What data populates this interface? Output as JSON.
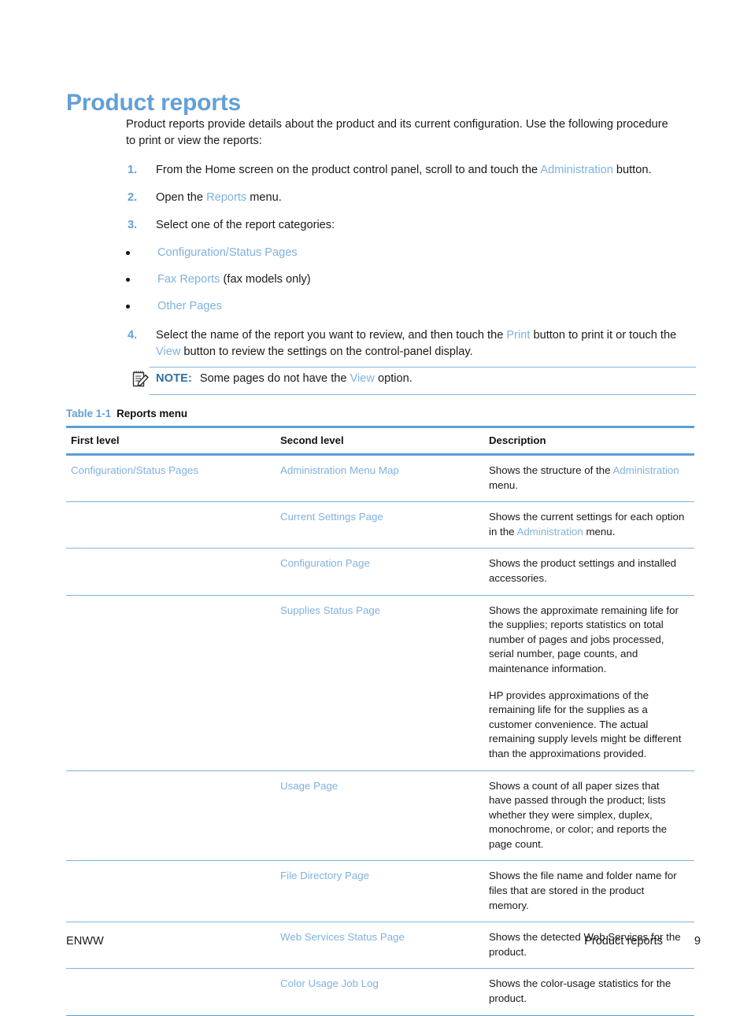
{
  "heading": "Product reports",
  "intro": "Product reports provide details about the product and its current configuration. Use the following procedure to print or view the reports:",
  "steps": [
    {
      "num": "1.",
      "parts": [
        {
          "t": "From the Home screen on the product control panel, scroll to and touch the ",
          "link": false
        },
        {
          "t": "Administration",
          "link": true
        },
        {
          "t": " button.",
          "link": false
        }
      ]
    },
    {
      "num": "2.",
      "parts": [
        {
          "t": "Open the ",
          "link": false
        },
        {
          "t": "Reports",
          "link": true
        },
        {
          "t": " menu.",
          "link": false
        }
      ]
    },
    {
      "num": "3.",
      "parts": [
        {
          "t": "Select one of the report categories:",
          "link": false
        }
      ]
    },
    {
      "num": "4.",
      "parts": [
        {
          "t": "Select the name of the report you want to review, and then touch the ",
          "link": false
        },
        {
          "t": "Print",
          "link": true
        },
        {
          "t": " button to print it or touch the ",
          "link": false
        },
        {
          "t": "View",
          "link": true
        },
        {
          "t": " button to review the settings on the control-panel display.",
          "link": false
        }
      ]
    }
  ],
  "bullets": [
    [
      {
        "t": "Configuration/Status Pages",
        "link": true
      }
    ],
    [
      {
        "t": "Fax Reports",
        "link": true
      },
      {
        "t": " (fax models only)",
        "link": false
      }
    ],
    [
      {
        "t": "Other Pages",
        "link": true
      }
    ]
  ],
  "note": {
    "icon": "note-pad-pencil-icon",
    "label": "NOTE:",
    "parts": [
      {
        "t": "Some pages do not have the ",
        "link": false
      },
      {
        "t": "View",
        "link": true
      },
      {
        "t": " option.",
        "link": false
      }
    ]
  },
  "table": {
    "caption_number": "Table 1-1",
    "caption_title": "Reports menu",
    "columns": [
      "First level",
      "Second level",
      "Description"
    ],
    "rows": [
      {
        "first": [
          {
            "t": "Configuration/Status Pages",
            "link": true
          }
        ],
        "second": [
          {
            "t": "Administration Menu Map",
            "link": true
          }
        ],
        "description": [
          [
            {
              "t": "Shows the structure of the ",
              "link": false
            },
            {
              "t": "Administration",
              "link": true
            },
            {
              "t": " menu.",
              "link": false
            }
          ]
        ]
      },
      {
        "first": [],
        "second": [
          {
            "t": "Current Settings Page",
            "link": true
          }
        ],
        "description": [
          [
            {
              "t": "Shows the current settings for each option in the ",
              "link": false
            },
            {
              "t": "Administration",
              "link": true
            },
            {
              "t": " menu.",
              "link": false
            }
          ]
        ]
      },
      {
        "first": [],
        "second": [
          {
            "t": "Configuration Page",
            "link": true
          }
        ],
        "description": [
          [
            {
              "t": "Shows the product settings and installed accessories.",
              "link": false
            }
          ]
        ]
      },
      {
        "first": [],
        "second": [
          {
            "t": "Supplies Status Page",
            "link": true
          }
        ],
        "description": [
          [
            {
              "t": "Shows the approximate remaining life for the supplies; reports statistics on total number of pages and jobs processed, serial number, page counts, and maintenance information.",
              "link": false
            }
          ],
          [
            {
              "t": "HP provides approximations of the remaining life for the supplies as a customer convenience. The actual remaining supply levels might be different than the approximations provided.",
              "link": false
            }
          ]
        ]
      },
      {
        "first": [],
        "second": [
          {
            "t": "Usage Page",
            "link": true
          }
        ],
        "description": [
          [
            {
              "t": "Shows a count of all paper sizes that have passed through the product; lists whether they were simplex, duplex, monochrome, or color; and reports the page count.",
              "link": false
            }
          ]
        ]
      },
      {
        "first": [],
        "second": [
          {
            "t": "File Directory Page",
            "link": true
          }
        ],
        "description": [
          [
            {
              "t": "Shows the file name and folder name for files that are stored in the product memory.",
              "link": false
            }
          ]
        ]
      },
      {
        "first": [],
        "second": [
          {
            "t": "Web Services Status Page",
            "link": true
          }
        ],
        "description": [
          [
            {
              "t": "Shows the detected Web Services for the product.",
              "link": false
            }
          ]
        ]
      },
      {
        "first": [],
        "second": [
          {
            "t": "Color Usage Job Log",
            "link": true
          }
        ],
        "description": [
          [
            {
              "t": "Shows the color-usage statistics for the product.",
              "link": false
            }
          ]
        ]
      }
    ]
  },
  "footer": {
    "left": "ENWW",
    "chapter": "Product reports",
    "page_number": "9"
  },
  "colors": {
    "heading_blue": "#62A0D4",
    "link_blue": "#7FB2DE",
    "rule_blue": "#5D9ED4",
    "note_label_blue": "#2E6FA8",
    "text_black": "#1a1a1a"
  }
}
